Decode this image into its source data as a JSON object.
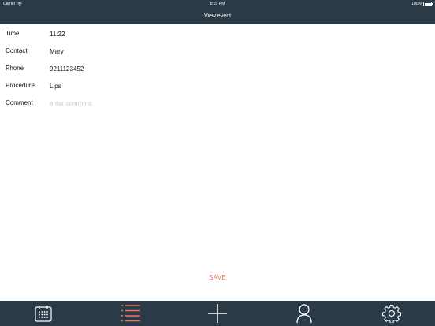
{
  "status_bar": {
    "carrier": "Carrier",
    "time": "8:53 PM",
    "battery": "100%",
    "battery_level": 1.0
  },
  "nav": {
    "title": "View event"
  },
  "form": {
    "time": {
      "label": "Time",
      "value": "11:22"
    },
    "contact": {
      "label": "Contact",
      "value": "Mary"
    },
    "phone": {
      "label": "Phone",
      "value": "9211123452"
    },
    "procedure": {
      "label": "Procedure",
      "value": "Lips"
    },
    "comment": {
      "label": "Comment",
      "value": "",
      "placeholder": "enter comment"
    }
  },
  "save_label": "SAVE",
  "tab_bar": {
    "tabs": [
      {
        "icon": "calendar-icon"
      },
      {
        "icon": "list-icon",
        "selected": true
      },
      {
        "icon": "plus-icon"
      },
      {
        "icon": "person-icon"
      },
      {
        "icon": "gear-icon"
      }
    ]
  },
  "colors": {
    "bar_background": "#2b3a47",
    "accent": "#f0735c",
    "icon": "#ffffff"
  }
}
